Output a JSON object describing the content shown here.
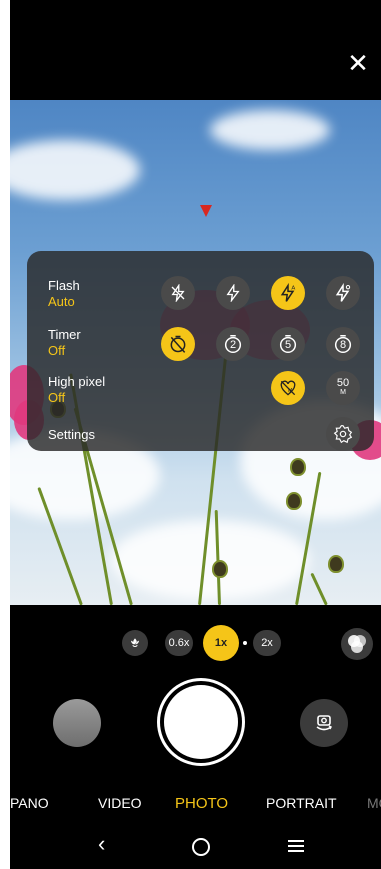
{
  "panel": {
    "flash": {
      "label": "Flash",
      "value": "Auto"
    },
    "timer": {
      "label": "Timer",
      "value": "Off",
      "opt2": "2",
      "opt5": "5",
      "opt8": "8"
    },
    "high_pixel": {
      "label": "High pixel",
      "value": "Off",
      "opt50": "50",
      "opt50_sub": "M"
    },
    "settings": {
      "label": "Settings"
    }
  },
  "zoom": {
    "z06": "0.6x",
    "z1": "1x",
    "z2": "2x"
  },
  "modes": {
    "pano": "PANO",
    "video": "VIDEO",
    "photo": "PHOTO",
    "portrait": "PORTRAIT",
    "more": "MO"
  },
  "colors": {
    "accent": "#f5c518",
    "annotation_arrow": "#d9281f"
  }
}
